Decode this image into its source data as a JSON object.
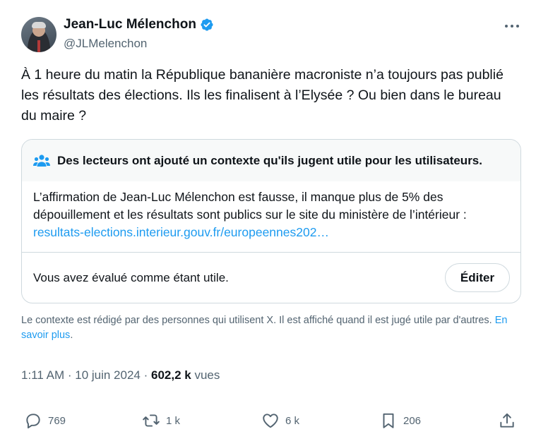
{
  "author": {
    "name": "Jean-Luc Mélenchon",
    "handle": "@JLMelenchon"
  },
  "tweet": {
    "text": "À 1 heure du matin la République bananière macroniste n’a toujours pas publié les résultats des élections. Ils les finalisent à l’Elysée ? Ou bien dans le bureau du maire ?"
  },
  "community_note": {
    "title": "Des lecteurs ont ajouté un contexte qu'ils jugent utile pour les utilisateurs.",
    "body": "L’affirmation de Jean-Luc Mélenchon est fausse, il manque plus de 5% des dépouillement et les résultats sont publics sur le site du ministère de l’intérieur : ",
    "link": "resultats-elections.interieur.gouv.fr/europeennes202…",
    "rated_text": "Vous avez évalué comme étant utile.",
    "edit_label": "Éditer"
  },
  "disclaimer": {
    "text": "Le contexte est rédigé par des personnes qui utilisent X. Il est affiché quand il est jugé utile par d'autres.",
    "link": "En savoir plus",
    "period": "."
  },
  "meta": {
    "time": "1:11 AM",
    "separator": " · ",
    "date": "10 juin 2024",
    "views_count": "602,2 k",
    "views_label": " vues"
  },
  "actions": {
    "replies": "769",
    "reposts": "1 k",
    "likes": "6 k",
    "bookmarks": "206"
  },
  "colors": {
    "accent": "#1d9bf0",
    "text": "#0f1419",
    "muted": "#536471",
    "border": "#cfd9de"
  }
}
